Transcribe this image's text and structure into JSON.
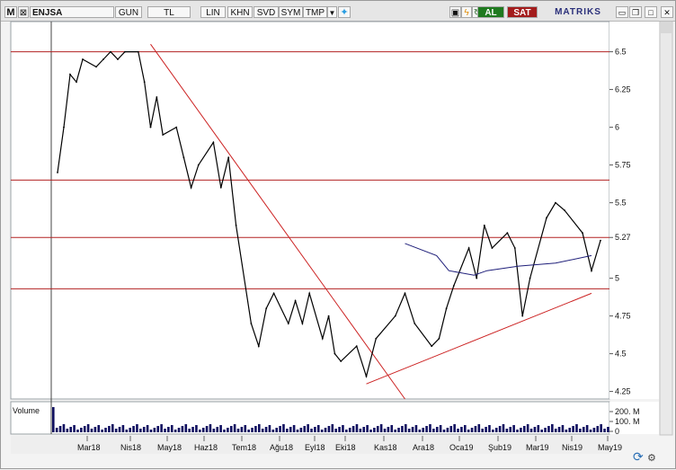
{
  "toolbar": {
    "logo_letter": "M",
    "symbol": "ENJSA",
    "period": "GUN",
    "currency": "TL",
    "scale": "LIN",
    "khn": "KHN",
    "svd": "SVD",
    "sym": "SYM",
    "tmp": "TMP",
    "buy": "AL",
    "sell": "SAT",
    "brand": "MATRIKS",
    "icons": [
      "dropdown-icon",
      "twitter-icon",
      "lock-icon",
      "bolt-icon",
      "refresh-icon",
      "minimize-icon",
      "restore-icon",
      "maximize-icon",
      "close-icon"
    ]
  },
  "colors": {
    "price": "#000000",
    "horizontal_levels": "#b22222",
    "trendlines": "#cc2222",
    "moving_average": "#1f1f7a",
    "volume": "#101060",
    "background": "#ffffff"
  },
  "chart_data": {
    "type": "line",
    "symbol": "ENJSA",
    "x_ticks": [
      "Mar18",
      "Nis18",
      "May18",
      "Haz18",
      "Tem18",
      "Ağu18",
      "Eyl18",
      "Eki18",
      "Kas18",
      "Ara18",
      "Oca19",
      "Şub19",
      "Mar19",
      "Nis19",
      "May19"
    ],
    "y_ticks": [
      6.5,
      6.25,
      6.0,
      5.75,
      5.5,
      5.27,
      5.0,
      4.75,
      4.5,
      4.25
    ],
    "ylim": [
      4.2,
      6.7
    ],
    "grid": false,
    "horizontal_levels": [
      6.5,
      5.65,
      5.27,
      4.93
    ],
    "trendlines": [
      {
        "name": "falling resistance",
        "from": {
          "x": "May18",
          "y": 6.55
        },
        "to": {
          "x": "Ara18",
          "y": 4.2
        }
      },
      {
        "name": "rising support",
        "from": {
          "x": "Kas18",
          "y": 4.3
        },
        "to": {
          "x": "May19",
          "y": 4.9
        }
      }
    ],
    "series": [
      {
        "type": "line",
        "points": [
          [
            "Mar18",
            5.7
          ],
          [
            "Mar18",
            6.0
          ],
          [
            "Mar18",
            6.35
          ],
          [
            "Mar18",
            6.3
          ],
          [
            "Mar18",
            6.45
          ],
          [
            "Nis18",
            6.4
          ],
          [
            "Nis18",
            6.45
          ],
          [
            "Nis18",
            6.5
          ],
          [
            "Nis18",
            6.45
          ],
          [
            "Nis18",
            6.5
          ],
          [
            "May18",
            6.5
          ],
          [
            "May18",
            6.3
          ],
          [
            "May18",
            6.0
          ],
          [
            "May18",
            6.2
          ],
          [
            "May18",
            5.95
          ],
          [
            "Haz18",
            6.0
          ],
          [
            "Haz18",
            5.8
          ],
          [
            "Haz18",
            5.6
          ],
          [
            "Haz18",
            5.75
          ],
          [
            "Tem18",
            5.9
          ],
          [
            "Tem18",
            5.6
          ],
          [
            "Tem18",
            5.8
          ],
          [
            "Tem18",
            5.35
          ],
          [
            "Ağu18",
            4.7
          ],
          [
            "Ağu18",
            4.55
          ],
          [
            "Ağu18",
            4.8
          ],
          [
            "Ağu18",
            4.9
          ],
          [
            "Eyl18",
            4.7
          ],
          [
            "Eyl18",
            4.85
          ],
          [
            "Eyl18",
            4.7
          ],
          [
            "Eyl18",
            4.9
          ],
          [
            "Eki18",
            4.6
          ],
          [
            "Eki18",
            4.75
          ],
          [
            "Eki18",
            4.5
          ],
          [
            "Eki18",
            4.45
          ],
          [
            "Kas18",
            4.55
          ],
          [
            "Kas18",
            4.35
          ],
          [
            "Kas18",
            4.6
          ],
          [
            "Ara18",
            4.75
          ],
          [
            "Ara18",
            4.9
          ],
          [
            "Ara18",
            4.7
          ],
          [
            "Oca19",
            4.55
          ],
          [
            "Oca19",
            4.6
          ],
          [
            "Oca19",
            4.8
          ],
          [
            "Oca19",
            4.95
          ],
          [
            "Şub19",
            5.2
          ],
          [
            "Şub19",
            5.0
          ],
          [
            "Şub19",
            5.35
          ],
          [
            "Şub19",
            5.2
          ],
          [
            "Mar19",
            5.3
          ],
          [
            "Mar19",
            5.2
          ],
          [
            "Mar19",
            4.75
          ],
          [
            "Mar19",
            5.0
          ],
          [
            "Nis19",
            5.4
          ],
          [
            "Nis19",
            5.5
          ],
          [
            "Nis19",
            5.45
          ],
          [
            "May19",
            5.3
          ],
          [
            "May19",
            5.05
          ],
          [
            "May19",
            5.25
          ]
        ]
      },
      {
        "type": "line",
        "points": [
          [
            "Ara18",
            5.23
          ],
          [
            "Oca19",
            5.15
          ],
          [
            "Oca19",
            5.05
          ],
          [
            "Şub19",
            5.02
          ],
          [
            "Şub19",
            5.05
          ],
          [
            "Mar19",
            5.08
          ],
          [
            "Nis19",
            5.1
          ],
          [
            "May19",
            5.15
          ]
        ]
      }
    ],
    "volume": {
      "label": "Volume",
      "y_ticks": [
        "200. M",
        "100. M",
        "0"
      ]
    }
  }
}
